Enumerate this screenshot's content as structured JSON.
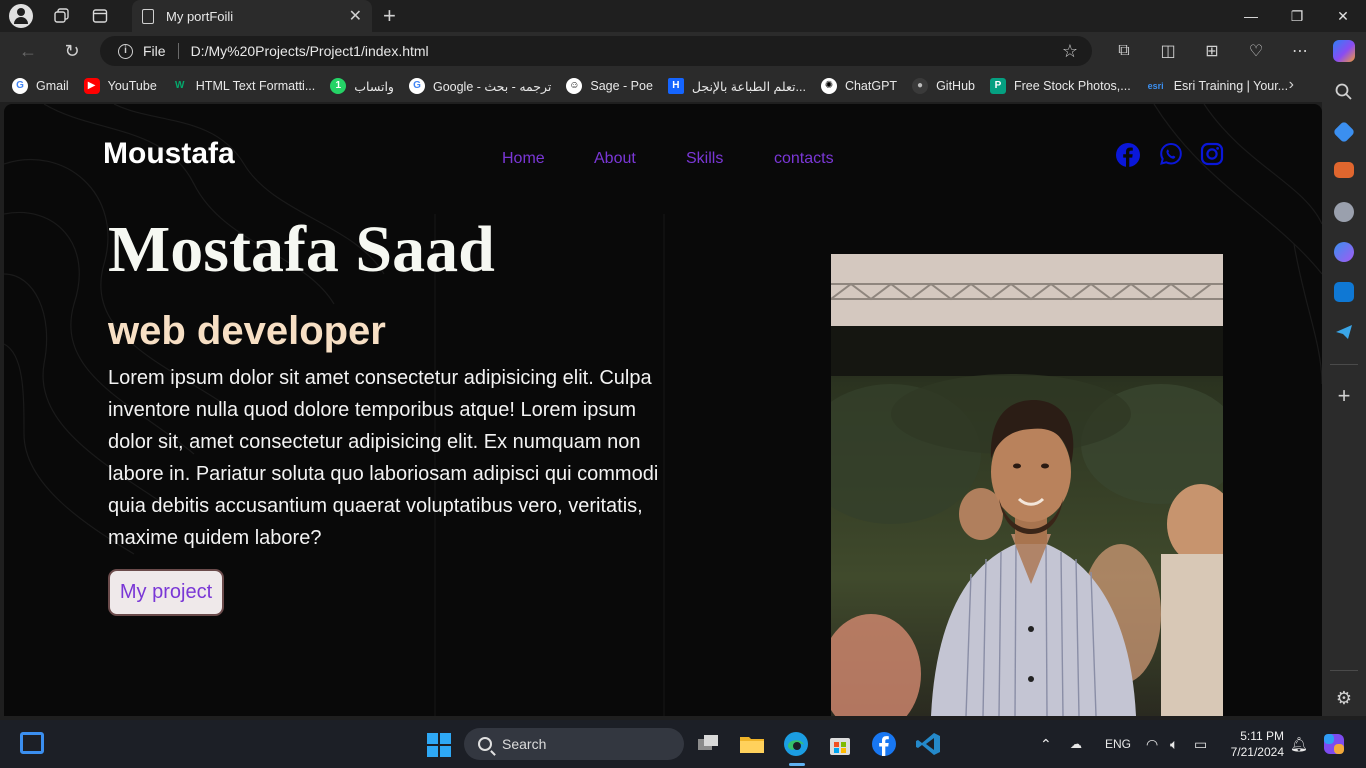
{
  "browser": {
    "tab_title": "My portFoili",
    "new_tab_symbol": "+",
    "omnibox_scheme": "File",
    "omnibox_url": "D:/My%20Projects/Project1/index.html",
    "window_controls": [
      "—",
      "❐",
      "✕"
    ]
  },
  "bookmarks": [
    {
      "label": "Gmail",
      "icon": "google-icon",
      "color": "#ffffff"
    },
    {
      "label": "YouTube",
      "icon": "youtube-icon",
      "color": "#ff0000"
    },
    {
      "label": "HTML Text Formatti...",
      "icon": "w3schools-icon",
      "color": "#04aa6d"
    },
    {
      "label": "واتساب",
      "icon": "whatsapp-icon",
      "color": "#25d366"
    },
    {
      "label": "Google - ترجمه - بحث",
      "icon": "google-icon",
      "color": "#ffffff"
    },
    {
      "label": "Sage - Poe",
      "icon": "poe-icon",
      "color": "#ffffff"
    },
    {
      "label": "تعلم الطباعة بالإنجل...",
      "icon": "h-icon",
      "color": "#1565ff"
    },
    {
      "label": "ChatGPT",
      "icon": "chatgpt-icon",
      "color": "#ffffff"
    },
    {
      "label": "GitHub",
      "icon": "github-icon",
      "color": "#6e6e6e"
    },
    {
      "label": "Free Stock Photos,...",
      "icon": "pexels-icon",
      "color": "#05a081"
    },
    {
      "label": "Esri Training | Your...",
      "icon": "esri-icon",
      "color": "#3b8ff0"
    }
  ],
  "page": {
    "logo": "Moustafa",
    "nav": [
      "Home",
      "About",
      "Skills",
      "contacts"
    ],
    "social_icons": [
      "facebook-icon",
      "whatsapp-icon",
      "instagram-icon"
    ],
    "hero_name": "Mostafa Saad",
    "hero_role": "web developer",
    "hero_description": "Lorem ipsum dolor sit amet consectetur adipisicing elit. Culpa inventore nulla quod dolore temporibus atque! Lorem ipsum dolor sit, amet consectetur adipisicing elit. Ex numquam non labore in. Pariatur soluta quo laboriosam adipisci qui commodi quia debitis accusantium quaerat voluptatibus vero, veritatis, maxime quidem labore?",
    "cta_label": "My project",
    "accent_color": "#7a37d6",
    "role_color": "#f7dfc4"
  },
  "taskbar": {
    "search_placeholder": "Search",
    "language": "ENG",
    "time": "5:11 PM",
    "date": "7/21/2024"
  }
}
